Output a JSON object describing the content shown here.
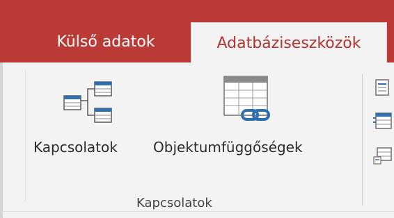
{
  "tabs": [
    {
      "label": "Külső adatok",
      "selected": false
    },
    {
      "label": "Adatbáziseszközök",
      "selected": true
    }
  ],
  "ribbon": {
    "groups": [
      {
        "label": "Kapcsolatok",
        "buttons": [
          {
            "label": "Kapcsolatok",
            "icon": "relationships-icon"
          },
          {
            "label": "Objektumfüggőségek",
            "icon": "object-dependencies-icon"
          }
        ]
      }
    ],
    "partial_buttons_icons": [
      "database-documenter-icon",
      "analyze-performance-icon",
      "analyze-table-icon"
    ]
  },
  "colors": {
    "accent": "#ba3a36",
    "accent_text": "#b4322f",
    "ribbon_bg": "#f3f3f3",
    "icon_blue": "#2e6fb0"
  }
}
